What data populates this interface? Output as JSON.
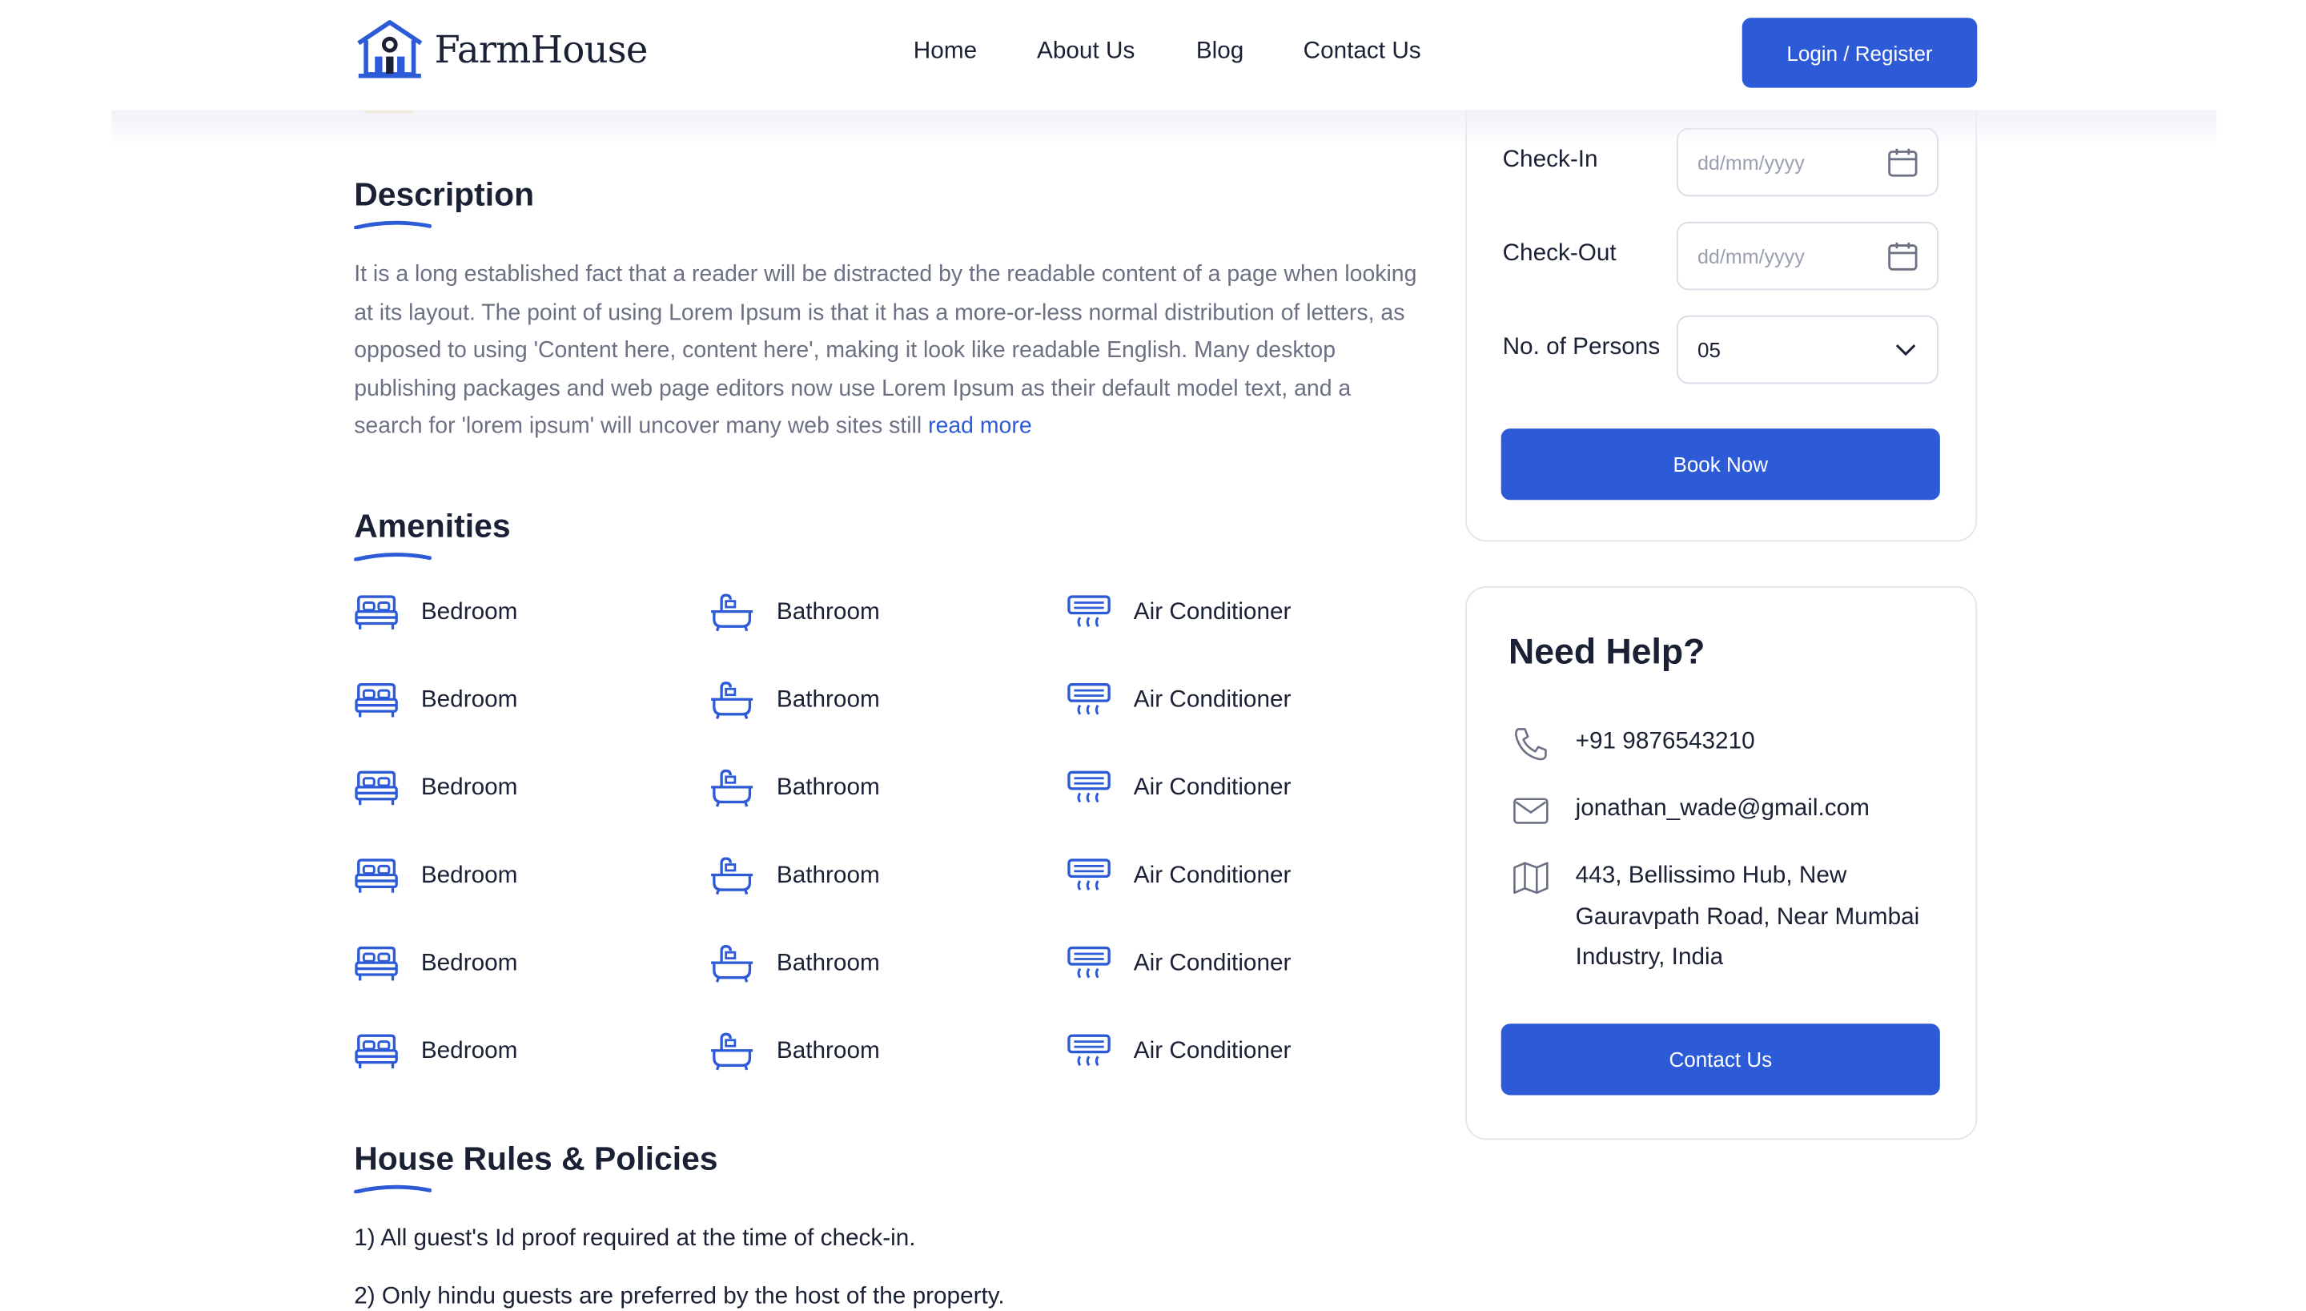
{
  "brand": {
    "name": "FarmHouse",
    "accent": "#2d5bd7"
  },
  "nav": {
    "items": [
      "Home",
      "About Us",
      "Blog",
      "Contact Us"
    ],
    "login_label": "Login / Register"
  },
  "description": {
    "title": "Description",
    "text": "It is a long established fact that a reader will be distracted by the readable content of a page when looking at its layout. The point of using Lorem Ipsum is that it has a more-or-less normal distribution of letters, as opposed to using 'Content here, content here', making it look like readable English. Many desktop publishing packages and web page editors now use Lorem Ipsum as their default model text, and a search for 'lorem ipsum' will uncover many web sites still",
    "read_more": "read more"
  },
  "amenities": {
    "title": "Amenities",
    "rows": [
      [
        "Bedroom",
        "Bathroom",
        "Air Conditioner"
      ],
      [
        "Bedroom",
        "Bathroom",
        "Air Conditioner"
      ],
      [
        "Bedroom",
        "Bathroom",
        "Air Conditioner"
      ],
      [
        "Bedroom",
        "Bathroom",
        "Air Conditioner"
      ],
      [
        "Bedroom",
        "Bathroom",
        "Air Conditioner"
      ],
      [
        "Bedroom",
        "Bathroom",
        "Air Conditioner"
      ]
    ],
    "icons": [
      "bed-icon",
      "bathtub-icon",
      "air-conditioner-icon"
    ]
  },
  "rules": {
    "title": "House Rules & Policies",
    "items": [
      "1) All guest's Id proof required at the time of check-in.",
      "2) Only hindu guests are preferred by the host of the property."
    ]
  },
  "booking": {
    "checkin_label": "Check-In",
    "checkin_placeholder": "dd/mm/yyyy",
    "checkout_label": "Check-Out",
    "checkout_placeholder": "dd/mm/yyyy",
    "persons_label": "No. of Persons",
    "persons_value": "05",
    "book_label": "Book Now"
  },
  "help": {
    "title": "Need Help?",
    "phone": "+91 9876543210",
    "email": "jonathan_wade@gmail.com",
    "address": "443, Bellissimo Hub, New Gauravpath Road, Near Mumbai Industry, India",
    "contact_label": "Contact Us"
  }
}
